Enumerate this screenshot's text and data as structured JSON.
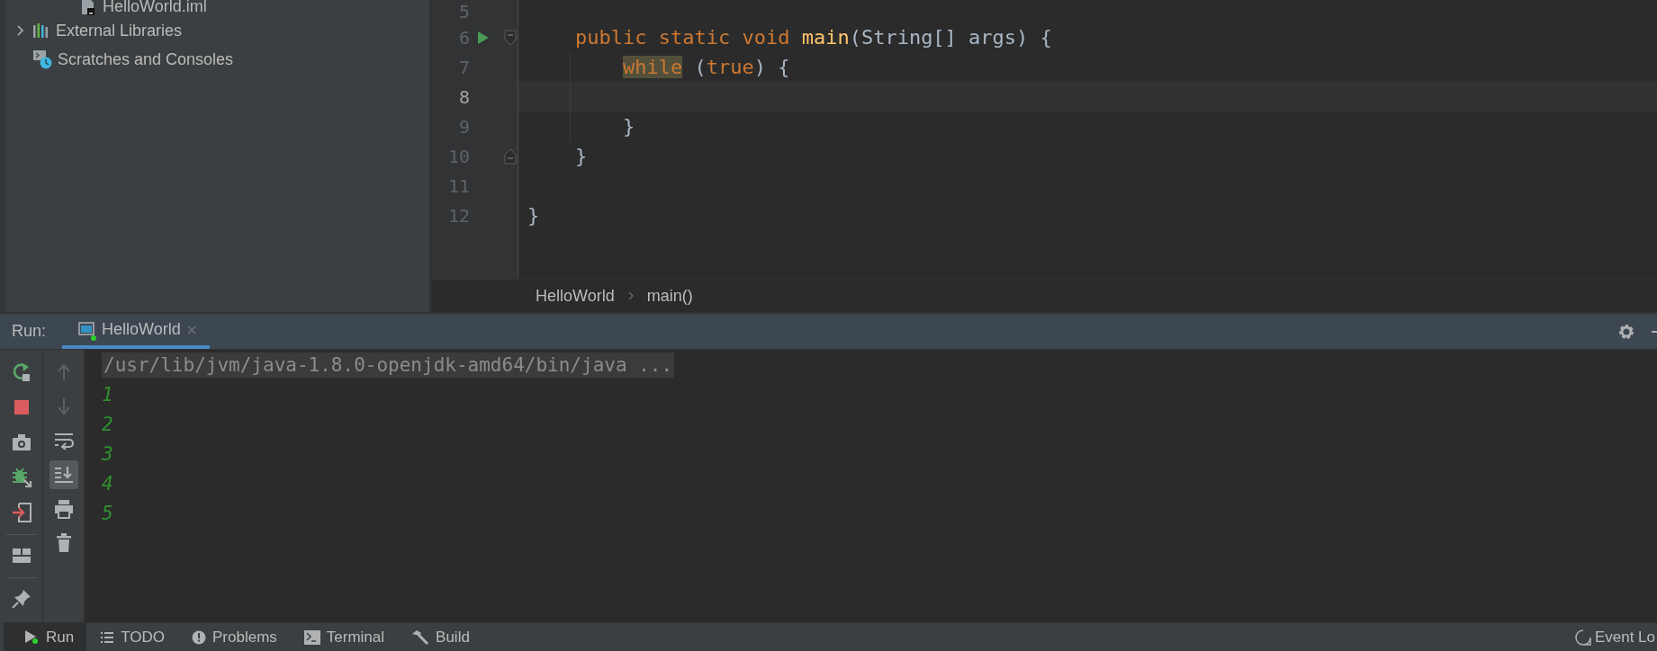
{
  "project_tree": {
    "items": [
      {
        "label": "HelloWorld.iml",
        "kind": "file"
      },
      {
        "label": "External Libraries",
        "kind": "library",
        "expanded": false
      },
      {
        "label": "Scratches and Consoles",
        "kind": "scratches"
      }
    ]
  },
  "editor": {
    "lines": [
      {
        "number": "5",
        "current": false
      },
      {
        "number": "6",
        "current": false,
        "run": true,
        "fold_open": true,
        "tokens": [
          {
            "text": "public static void ",
            "kind": "keyword"
          },
          {
            "text": "main",
            "kind": "method"
          },
          {
            "text": "(String[] args) {",
            "kind": "plain"
          }
        ]
      },
      {
        "number": "7",
        "current": false,
        "tokens": [
          {
            "text": "while",
            "kind": "keyword",
            "highlighted": true
          },
          {
            "text": " (",
            "kind": "plain"
          },
          {
            "text": "true",
            "kind": "keyword"
          },
          {
            "text": ") {",
            "kind": "plain"
          }
        ]
      },
      {
        "number": "8",
        "current": true
      },
      {
        "number": "9",
        "current": false,
        "tokens": [
          {
            "text": "}",
            "kind": "plain"
          }
        ]
      },
      {
        "number": "10",
        "current": false,
        "fold_close": true,
        "tokens": [
          {
            "text": "}",
            "kind": "plain"
          }
        ]
      },
      {
        "number": "11",
        "current": false
      },
      {
        "number": "12",
        "current": false,
        "tokens": [
          {
            "text": "}",
            "kind": "plain"
          }
        ]
      }
    ],
    "breadcrumbs": [
      "HelloWorld",
      "main()"
    ]
  },
  "run_panel": {
    "label": "Run:",
    "tabs": [
      {
        "label": "HelloWorld",
        "selected": true,
        "running": true
      }
    ],
    "toolbar_left": [
      {
        "kind": "rerun"
      },
      {
        "kind": "stop"
      },
      {
        "kind": "camera"
      },
      {
        "kind": "debug"
      },
      {
        "kind": "exit"
      },
      {
        "kind": "layout",
        "separator": true
      },
      {
        "kind": "pin",
        "separator": true
      }
    ],
    "toolbar_right": [
      {
        "kind": "up",
        "disabled": true,
        "selected": false
      },
      {
        "kind": "down",
        "disabled": true,
        "selected": false
      },
      {
        "kind": "wrap",
        "disabled": false,
        "selected": false
      },
      {
        "kind": "scroll-end",
        "disabled": false,
        "selected": true
      },
      {
        "kind": "print",
        "disabled": false,
        "selected": false
      },
      {
        "kind": "trash",
        "disabled": false,
        "selected": false
      }
    ],
    "console": [
      {
        "text": "/usr/lib/jvm/java-1.8.0-openjdk-amd64/bin/java ...",
        "kind": "command"
      },
      {
        "text": "1",
        "kind": "stdout"
      },
      {
        "text": "2",
        "kind": "stdout"
      },
      {
        "text": "3",
        "kind": "stdout"
      },
      {
        "text": "4",
        "kind": "stdout"
      },
      {
        "text": "5",
        "kind": "stdout"
      }
    ]
  },
  "bottom_bar": {
    "tabs": [
      {
        "label": "Run",
        "kind": "run",
        "selected": true,
        "running": true
      },
      {
        "label": "TODO",
        "kind": "todo",
        "selected": false,
        "running": false
      },
      {
        "label": "Problems",
        "kind": "problems",
        "selected": false,
        "running": false
      },
      {
        "label": "Terminal",
        "kind": "terminal",
        "selected": false,
        "running": false
      },
      {
        "label": "Build",
        "kind": "build",
        "selected": false,
        "running": false
      }
    ],
    "event_log": "Event Lo"
  }
}
